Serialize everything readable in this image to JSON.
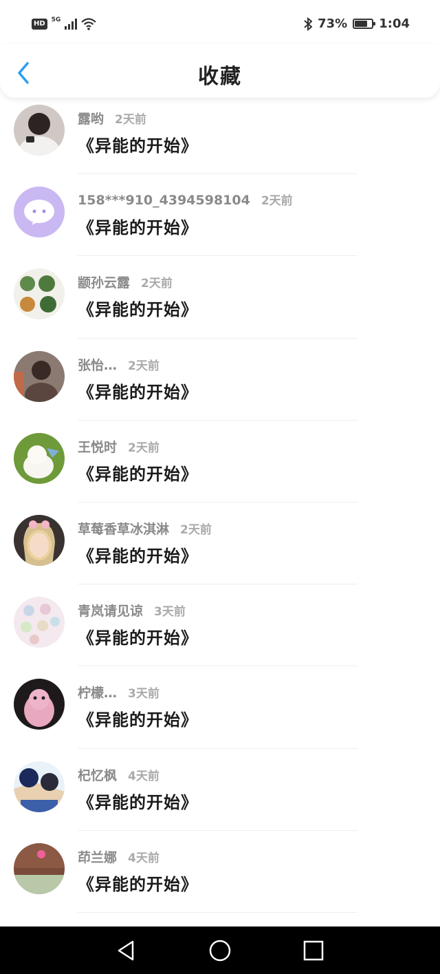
{
  "status_bar": {
    "hd": "HD",
    "network": "5G",
    "battery_text": "73%",
    "battery_level": 0.73,
    "time": "1:04"
  },
  "header": {
    "title": "收藏"
  },
  "favorites": [
    {
      "user": "露哟",
      "time": "2天前",
      "book": "《异能的开始》"
    },
    {
      "user": "158***910_4394598104",
      "time": "2天前",
      "book": "《异能的开始》"
    },
    {
      "user": "颛孙云露",
      "time": "2天前",
      "book": "《异能的开始》"
    },
    {
      "user": "张怡…",
      "time": "2天前",
      "book": "《异能的开始》"
    },
    {
      "user": "王悦时",
      "time": "2天前",
      "book": "《异能的开始》"
    },
    {
      "user": "草莓香草冰淇淋",
      "time": "2天前",
      "book": "《异能的开始》"
    },
    {
      "user": "青岚请见谅",
      "time": "3天前",
      "book": "《异能的开始》"
    },
    {
      "user": "柠檬…",
      "time": "3天前",
      "book": "《异能的开始》"
    },
    {
      "user": "杞忆枫",
      "time": "4天前",
      "book": "《异能的开始》"
    },
    {
      "user": "茚兰娜",
      "time": "4天前",
      "book": "《异能的开始》"
    }
  ],
  "colors": {
    "accent": "#2a9df4",
    "username": "#8a8a8a",
    "time": "#aaaaaa"
  }
}
